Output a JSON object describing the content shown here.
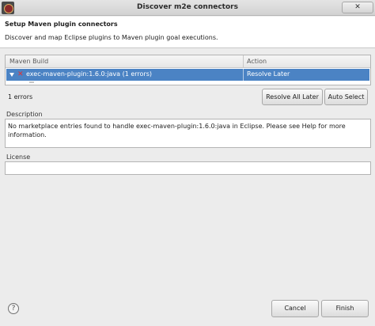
{
  "window": {
    "title": "Discover m2e connectors",
    "close_label": "✕"
  },
  "header": {
    "title": "Setup Maven plugin connectors",
    "description": "Discover and map Eclipse plugins to Maven plugin goal executions."
  },
  "tree": {
    "columns": [
      "Maven Build",
      "Action"
    ],
    "rows": [
      {
        "label": "exec-maven-plugin:1.6.0:java (1 errors)",
        "action": "Resolve Later",
        "selected": true,
        "icon": "error-icon"
      }
    ]
  },
  "status": {
    "errors_text": "1 errors"
  },
  "buttons": {
    "resolve_all_later": "Resolve All Later",
    "auto_select": "Auto Select",
    "cancel": "Cancel",
    "finish": "Finish",
    "help": "?"
  },
  "description_section": {
    "label": "Description",
    "text": "No marketplace entries found to handle exec-maven-plugin:1.6.0:java in Eclipse.  Please see Help for more information."
  },
  "license_section": {
    "label": "License",
    "text": ""
  },
  "colors": {
    "selection": "#4b83c4",
    "error": "#e83030"
  }
}
